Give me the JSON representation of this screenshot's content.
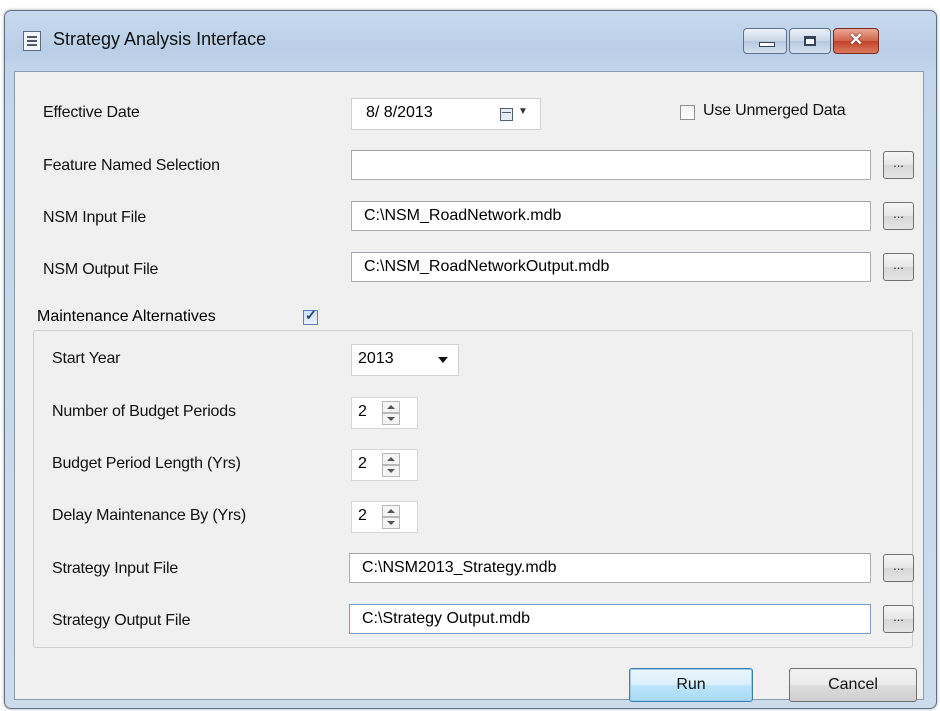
{
  "window": {
    "title": "Strategy Analysis Interface",
    "close_glyph": "✕"
  },
  "icons": [
    "app-icon",
    "minimize-icon",
    "maximize-icon",
    "close-icon",
    "calendar-icon",
    "dropdown-arrow-icon",
    "spin-up-icon",
    "spin-down-icon"
  ],
  "form": {
    "effective_date_label": "Effective Date",
    "effective_date_value": "8/ 8/2013",
    "calendar_arrow": "▼",
    "use_unmerged_label": "Use Unmerged Data",
    "use_unmerged_checked": false,
    "feature_named_selection_label": "Feature Named Selection",
    "feature_named_selection_value": "",
    "nsm_input_label": "NSM Input File",
    "nsm_input_value": "C:\\NSM_RoadNetwork.mdb",
    "nsm_output_label": "NSM Output File",
    "nsm_output_value": "C:\\NSM_RoadNetworkOutput.mdb",
    "browse_label": "..."
  },
  "maintenance": {
    "group_label": "Maintenance Alternatives",
    "enabled": true,
    "check_glyph": "✓",
    "start_year_label": "Start Year",
    "start_year_value": "2013",
    "budget_periods_label": "Number of Budget Periods",
    "budget_periods_value": "2",
    "period_length_label": "Budget Period Length (Yrs)",
    "period_length_value": "2",
    "delay_label": "Delay Maintenance By (Yrs)",
    "delay_value": "2",
    "strategy_input_label": "Strategy Input  File",
    "strategy_input_value": "C:\\NSM2013_Strategy.mdb",
    "strategy_output_label": "Strategy Output File",
    "strategy_output_value": "C:\\Strategy Output.mdb"
  },
  "buttons": {
    "run": "Run",
    "cancel": "Cancel"
  }
}
